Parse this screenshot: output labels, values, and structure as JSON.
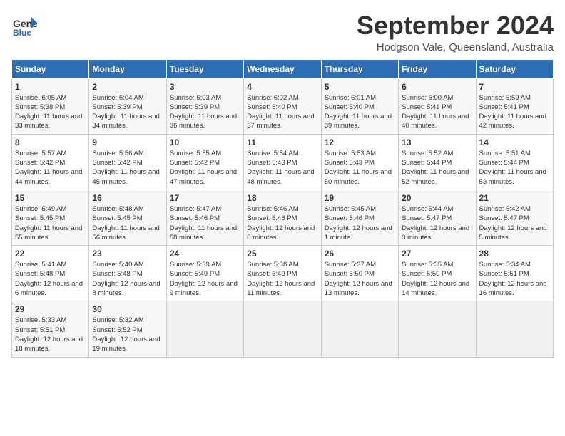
{
  "header": {
    "logo_line1": "General",
    "logo_line2": "Blue",
    "month": "September 2024",
    "location": "Hodgson Vale, Queensland, Australia"
  },
  "weekdays": [
    "Sunday",
    "Monday",
    "Tuesday",
    "Wednesday",
    "Thursday",
    "Friday",
    "Saturday"
  ],
  "days": [
    {
      "num": "1",
      "sunrise": "6:05 AM",
      "sunset": "5:38 PM",
      "daylight": "11 hours and 33 minutes."
    },
    {
      "num": "2",
      "sunrise": "6:04 AM",
      "sunset": "5:39 PM",
      "daylight": "11 hours and 34 minutes."
    },
    {
      "num": "3",
      "sunrise": "6:03 AM",
      "sunset": "5:39 PM",
      "daylight": "11 hours and 36 minutes."
    },
    {
      "num": "4",
      "sunrise": "6:02 AM",
      "sunset": "5:40 PM",
      "daylight": "11 hours and 37 minutes."
    },
    {
      "num": "5",
      "sunrise": "6:01 AM",
      "sunset": "5:40 PM",
      "daylight": "11 hours and 39 minutes."
    },
    {
      "num": "6",
      "sunrise": "6:00 AM",
      "sunset": "5:41 PM",
      "daylight": "11 hours and 40 minutes."
    },
    {
      "num": "7",
      "sunrise": "5:59 AM",
      "sunset": "5:41 PM",
      "daylight": "11 hours and 42 minutes."
    },
    {
      "num": "8",
      "sunrise": "5:57 AM",
      "sunset": "5:42 PM",
      "daylight": "11 hours and 44 minutes."
    },
    {
      "num": "9",
      "sunrise": "5:56 AM",
      "sunset": "5:42 PM",
      "daylight": "11 hours and 45 minutes."
    },
    {
      "num": "10",
      "sunrise": "5:55 AM",
      "sunset": "5:42 PM",
      "daylight": "11 hours and 47 minutes."
    },
    {
      "num": "11",
      "sunrise": "5:54 AM",
      "sunset": "5:43 PM",
      "daylight": "11 hours and 48 minutes."
    },
    {
      "num": "12",
      "sunrise": "5:53 AM",
      "sunset": "5:43 PM",
      "daylight": "11 hours and 50 minutes."
    },
    {
      "num": "13",
      "sunrise": "5:52 AM",
      "sunset": "5:44 PM",
      "daylight": "11 hours and 52 minutes."
    },
    {
      "num": "14",
      "sunrise": "5:51 AM",
      "sunset": "5:44 PM",
      "daylight": "11 hours and 53 minutes."
    },
    {
      "num": "15",
      "sunrise": "5:49 AM",
      "sunset": "5:45 PM",
      "daylight": "11 hours and 55 minutes."
    },
    {
      "num": "16",
      "sunrise": "5:48 AM",
      "sunset": "5:45 PM",
      "daylight": "11 hours and 56 minutes."
    },
    {
      "num": "17",
      "sunrise": "5:47 AM",
      "sunset": "5:46 PM",
      "daylight": "11 hours and 58 minutes."
    },
    {
      "num": "18",
      "sunrise": "5:46 AM",
      "sunset": "5:46 PM",
      "daylight": "12 hours and 0 minutes."
    },
    {
      "num": "19",
      "sunrise": "5:45 AM",
      "sunset": "5:46 PM",
      "daylight": "12 hours and 1 minute."
    },
    {
      "num": "20",
      "sunrise": "5:44 AM",
      "sunset": "5:47 PM",
      "daylight": "12 hours and 3 minutes."
    },
    {
      "num": "21",
      "sunrise": "5:42 AM",
      "sunset": "5:47 PM",
      "daylight": "12 hours and 5 minutes."
    },
    {
      "num": "22",
      "sunrise": "5:41 AM",
      "sunset": "5:48 PM",
      "daylight": "12 hours and 6 minutes."
    },
    {
      "num": "23",
      "sunrise": "5:40 AM",
      "sunset": "5:48 PM",
      "daylight": "12 hours and 8 minutes."
    },
    {
      "num": "24",
      "sunrise": "5:39 AM",
      "sunset": "5:49 PM",
      "daylight": "12 hours and 9 minutes."
    },
    {
      "num": "25",
      "sunrise": "5:38 AM",
      "sunset": "5:49 PM",
      "daylight": "12 hours and 11 minutes."
    },
    {
      "num": "26",
      "sunrise": "5:37 AM",
      "sunset": "5:50 PM",
      "daylight": "12 hours and 13 minutes."
    },
    {
      "num": "27",
      "sunrise": "5:35 AM",
      "sunset": "5:50 PM",
      "daylight": "12 hours and 14 minutes."
    },
    {
      "num": "28",
      "sunrise": "5:34 AM",
      "sunset": "5:51 PM",
      "daylight": "12 hours and 16 minutes."
    },
    {
      "num": "29",
      "sunrise": "5:33 AM",
      "sunset": "5:51 PM",
      "daylight": "12 hours and 18 minutes."
    },
    {
      "num": "30",
      "sunrise": "5:32 AM",
      "sunset": "5:52 PM",
      "daylight": "12 hours and 19 minutes."
    }
  ],
  "labels": {
    "sunrise": "Sunrise:",
    "sunset": "Sunset:",
    "daylight": "Daylight:"
  }
}
